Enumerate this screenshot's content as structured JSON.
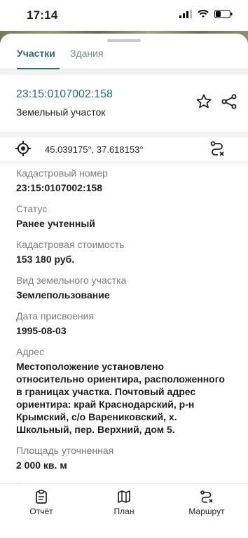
{
  "status_bar": {
    "time": "17:14"
  },
  "tabs": [
    {
      "label": "Участки",
      "active": true
    },
    {
      "label": "Здания",
      "active": false
    }
  ],
  "header": {
    "cadastral_number_link": "23:15:0107002:158",
    "subtitle": "Земельный участок"
  },
  "coords": {
    "text": "45.039175°, 37.618153°"
  },
  "fields": [
    {
      "label": "Кадастровый номер",
      "value": "23:15:0107002:158"
    },
    {
      "label": "Статус",
      "value": "Ранее учтенный"
    },
    {
      "label": "Кадастровая стоимость",
      "value": "153 180 руб."
    },
    {
      "label": "Вид земельного участка",
      "value": "Землепользование"
    },
    {
      "label": "Дата присвоения",
      "value": "1995-08-03"
    },
    {
      "label": "Адрес",
      "value": "Местоположение установлено относительно ориентира, расположенного в границах участка. Почтовый адрес ориентира: край Краснодарский, р-н Крымский, с/о Варениковский, х. Школьный, пер. Верхний, дом 5."
    },
    {
      "label": "Площадь уточненная",
      "value": "2 000 кв. м"
    },
    {
      "label": "Категория земель",
      "value": ""
    }
  ],
  "bottom_nav": [
    {
      "label": "Отчёт",
      "icon": "clipboard-icon"
    },
    {
      "label": "План",
      "icon": "map-icon"
    },
    {
      "label": "Маршрут",
      "icon": "route-icon"
    }
  ],
  "colors": {
    "accent": "#2e6b6b"
  }
}
